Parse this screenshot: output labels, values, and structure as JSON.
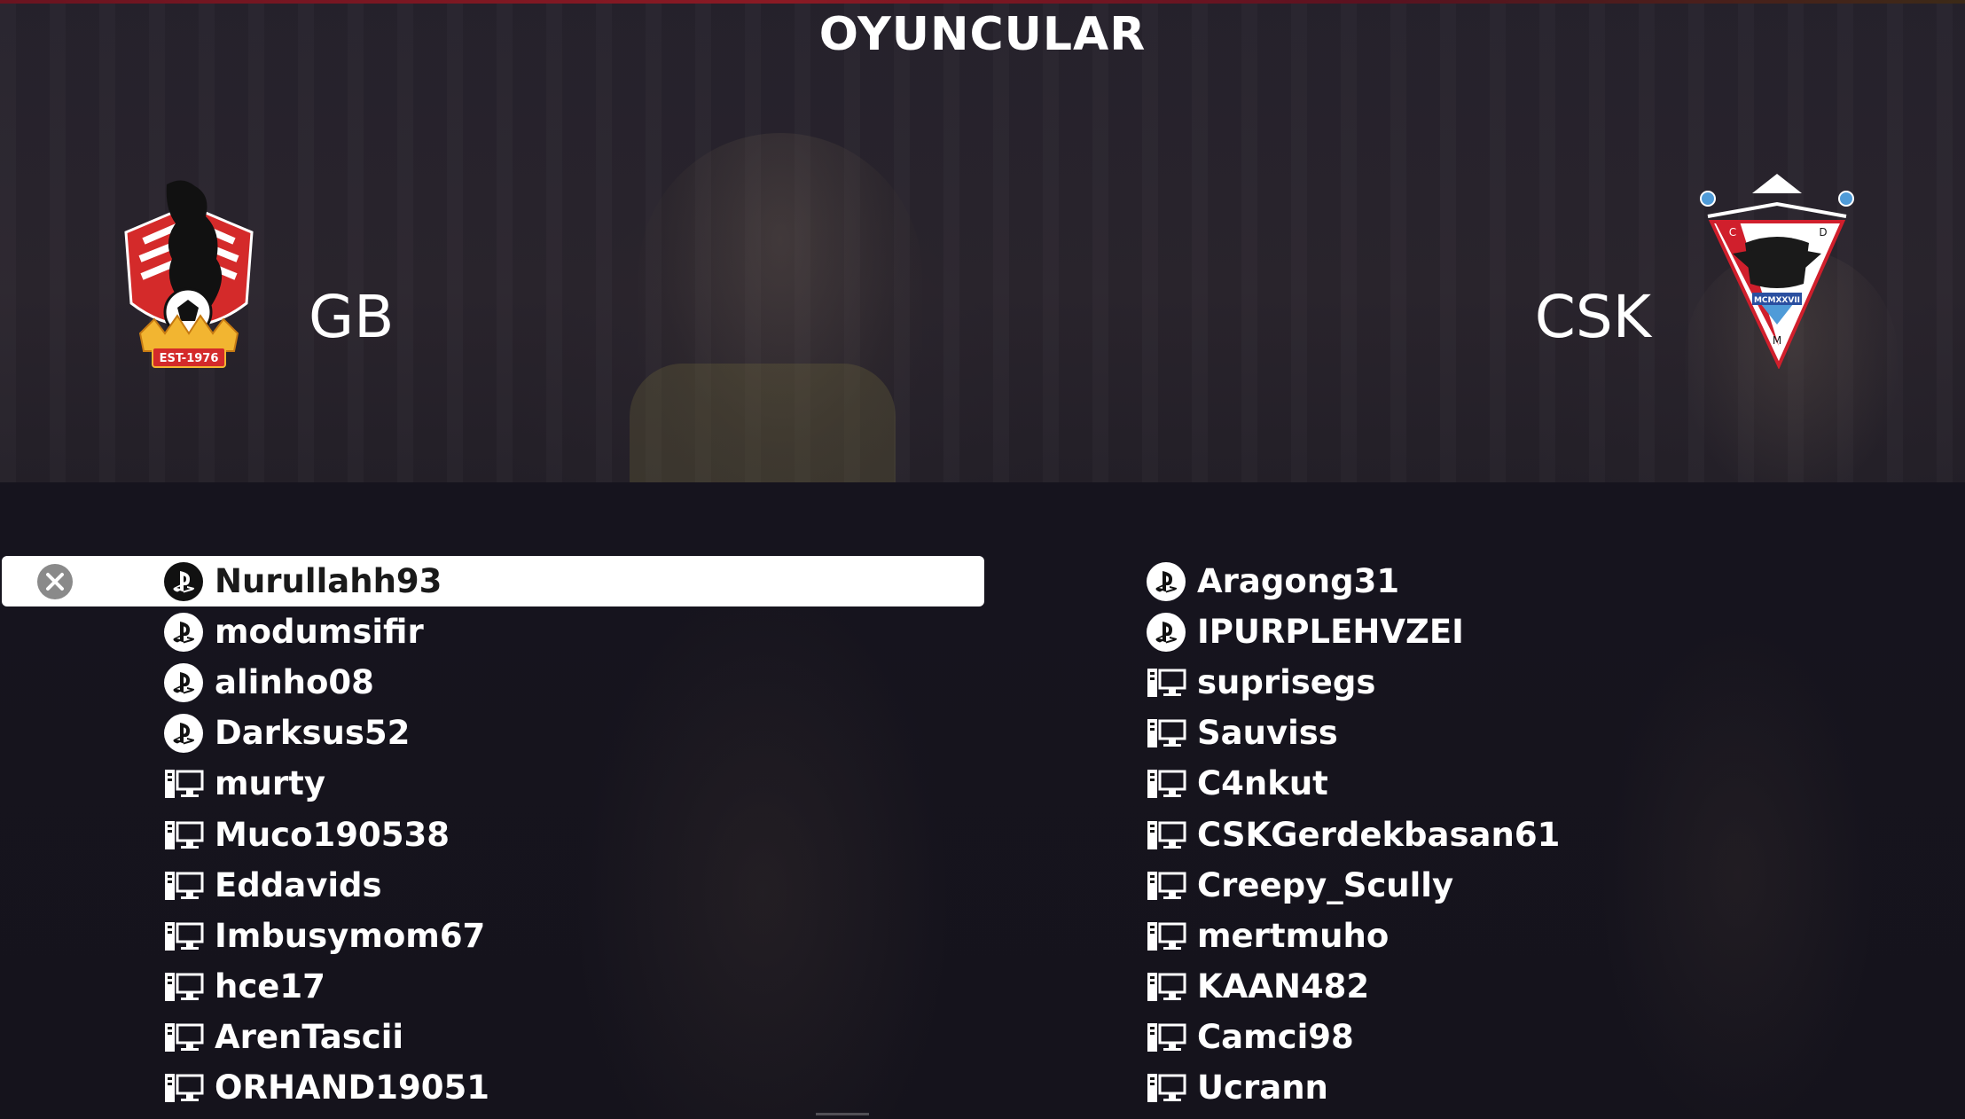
{
  "screen": {
    "title": "OYUNCULAR"
  },
  "teams": {
    "home": {
      "abbr": "GB",
      "crest_icon": "bear-crest-icon",
      "crest_text": "EST-1976"
    },
    "away": {
      "abbr": "CSK",
      "crest_icon": "eagle-crest-icon",
      "crest_text": "MCMXXVII"
    }
  },
  "home_players": [
    {
      "name": "Nurullahh93",
      "platform": "playstation",
      "selected": true
    },
    {
      "name": "modumsifir",
      "platform": "playstation"
    },
    {
      "name": "alinho08",
      "platform": "playstation"
    },
    {
      "name": "Darksus52",
      "platform": "playstation"
    },
    {
      "name": "murty",
      "platform": "pc"
    },
    {
      "name": "Muco190538",
      "platform": "pc"
    },
    {
      "name": "Eddavids",
      "platform": "pc"
    },
    {
      "name": "Imbusymom67",
      "platform": "pc"
    },
    {
      "name": "hce17",
      "platform": "pc"
    },
    {
      "name": "ArenTascii",
      "platform": "pc"
    },
    {
      "name": "ORHAND19051",
      "platform": "pc"
    }
  ],
  "away_players": [
    {
      "name": "Aragong31",
      "platform": "playstation"
    },
    {
      "name": "IPURPLEHVZEI",
      "platform": "playstation"
    },
    {
      "name": "suprisegs",
      "platform": "pc"
    },
    {
      "name": "Sauviss",
      "platform": "pc"
    },
    {
      "name": "C4nkut",
      "platform": "pc"
    },
    {
      "name": "CSKGerdekbasan61",
      "platform": "pc"
    },
    {
      "name": "Creepy_Scully",
      "platform": "pc"
    },
    {
      "name": "mertmuho",
      "platform": "pc"
    },
    {
      "name": "KAAN482",
      "platform": "pc"
    },
    {
      "name": "Camci98",
      "platform": "pc"
    },
    {
      "name": "Ucrann",
      "platform": "pc"
    }
  ],
  "colors": {
    "selected_row": "#ffffff",
    "background": "#14121c",
    "text": "#ffffff"
  }
}
